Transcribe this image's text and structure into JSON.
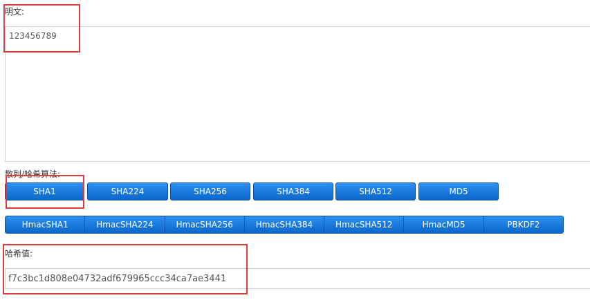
{
  "plaintext": {
    "label": "明文:",
    "value": "123456789"
  },
  "algorithm": {
    "label": "散列/哈希算法:",
    "row1": [
      "SHA1",
      "SHA224",
      "SHA256",
      "SHA384",
      "SHA512",
      "MD5"
    ],
    "row2": [
      "HmacSHA1",
      "HmacSHA224",
      "HmacSHA256",
      "HmacSHA384",
      "HmacSHA512",
      "HmacMD5",
      "PBKDF2"
    ]
  },
  "hash": {
    "label": "哈希值:",
    "value": "f7c3bc1d808e04732adf679965ccc34ca7ae3441"
  },
  "colors": {
    "button_blue": "#0b67cc",
    "highlight_red": "#e23b3b"
  }
}
